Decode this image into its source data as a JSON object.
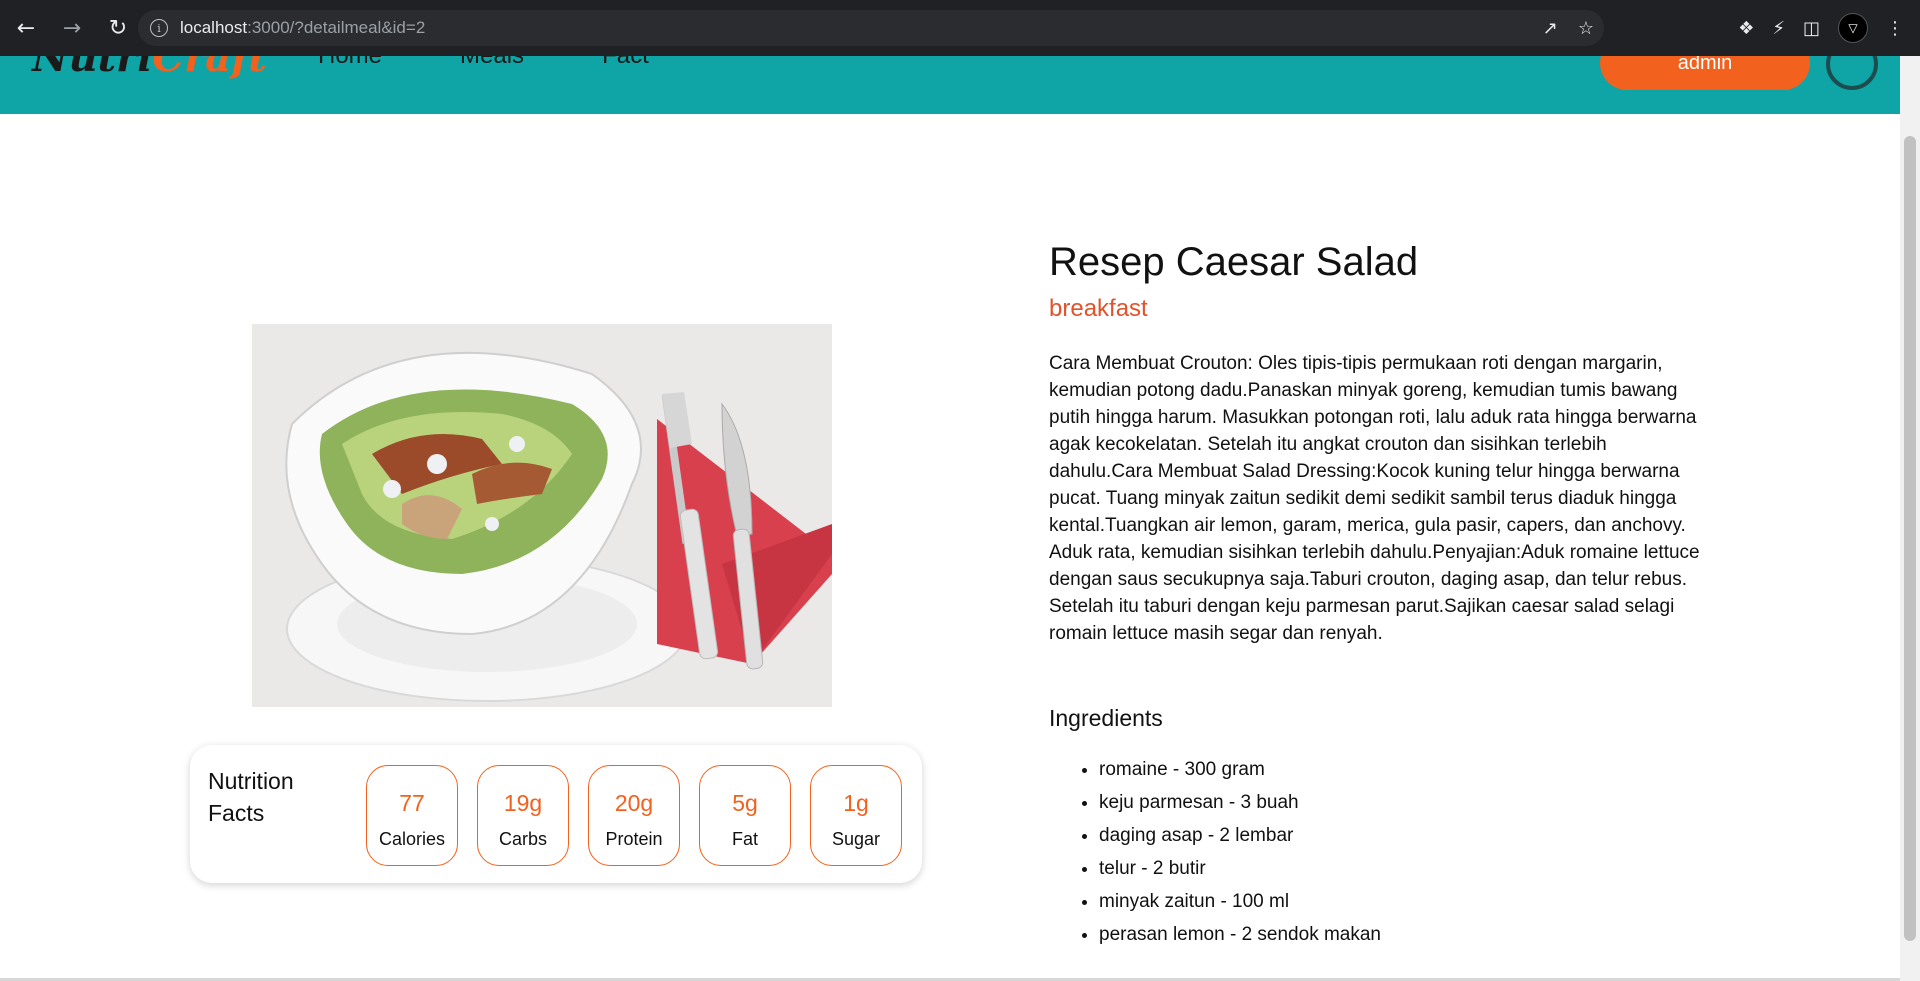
{
  "browser": {
    "url_host": "localhost",
    "url_rest": ":3000/?detailmeal&id=2"
  },
  "site": {
    "logo_part1": "Nutri",
    "logo_part2": "Craft",
    "nav": [
      "Home",
      "Meals",
      "Fact"
    ],
    "admin_label": "admin"
  },
  "meal": {
    "title": "Resep Caesar Salad",
    "category": "breakfast",
    "description": "Cara Membuat Crouton: Oles tipis-tipis permukaan roti dengan margarin, kemudian potong dadu.Panaskan minyak goreng, kemudian tumis bawang putih hingga harum. Masukkan potongan roti, lalu aduk rata hingga berwarna agak kecokelatan. Setelah itu angkat crouton dan sisihkan terlebih dahulu.Cara Membuat Salad Dressing:Kocok kuning telur hingga berwarna pucat. Tuang minyak zaitun sedikit demi sedikit sambil terus diaduk hingga kental.Tuangkan air lemon, garam, merica, gula pasir, capers, dan anchovy. Aduk rata, kemudian sisihkan terlebih dahulu.Penyajian:Aduk romaine lettuce dengan saus secukupnya saja.Taburi crouton, daging asap, dan telur rebus. Setelah itu taburi dengan keju parmesan parut.Sajikan caesar salad selagi romain lettuce masih segar dan renyah."
  },
  "nutrition": {
    "title": "Nutrition Facts",
    "items": [
      {
        "value": "77",
        "label": "Calories"
      },
      {
        "value": "19g",
        "label": "Carbs"
      },
      {
        "value": "20g",
        "label": "Protein"
      },
      {
        "value": "5g",
        "label": "Fat"
      },
      {
        "value": "1g",
        "label": "Sugar"
      }
    ]
  },
  "ingredients": {
    "heading": "Ingredients",
    "items": [
      "romaine - 300 gram",
      "keju parmesan - 3 buah",
      "daging asap - 2 lembar",
      "telur - 2 butir",
      "minyak zaitun - 100 ml",
      "perasan lemon - 2 sendok makan"
    ]
  },
  "colors": {
    "header_teal": "#0fa5a6",
    "accent_orange": "#f2611d",
    "category_red": "#e2522b"
  }
}
